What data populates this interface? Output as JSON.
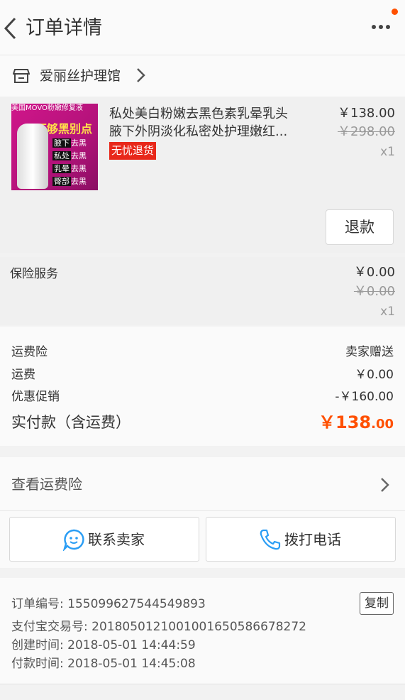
{
  "header": {
    "title": "订单详情",
    "back_icon": "chevron-left-icon",
    "more_icon": "more-icon",
    "accent": "#ff5000"
  },
  "shop": {
    "name": "爱丽丝护理馆",
    "icon": "shop-icon"
  },
  "product": {
    "thumb_top": "美国MOVO粉嫩修复液",
    "thumb_headline": "不够黑别点",
    "thumb_tags": [
      "腋下",
      "去黑",
      "私处",
      "去黑",
      "乳晕",
      "去黑",
      "臀部",
      "去黑"
    ],
    "title_line1": "私处美白粉嫩去黑色素乳晕乳头",
    "title_line2": "腋下外阴淡化私密处护理嫩红...",
    "badge": "无忧退货",
    "price": "￥138.00",
    "original_price": "￥298.00",
    "quantity": "x1",
    "refund_label": "退款"
  },
  "insurance": {
    "label": "保险服务",
    "price": "￥0.00",
    "original_price": "￥0.00",
    "quantity": "x1"
  },
  "summary": {
    "rows": [
      {
        "label": "运费险",
        "value": "卖家赠送"
      },
      {
        "label": "运费",
        "value": "￥0.00"
      },
      {
        "label": "优惠促销",
        "value": "-￥160.00"
      }
    ],
    "total_label": "实付款（含运费）",
    "total_int": "￥138",
    "total_dec": ".00"
  },
  "view_insurance": {
    "label": "查看运费险"
  },
  "actions": {
    "contact_label": "联系卖家",
    "call_label": "拨打电话"
  },
  "order_info": {
    "order_no": "订单编号: 1550996275445498 93",
    "alipay_no": "支付宝交易号: 2018050121001001650586678272",
    "created": "创建时间: 2018-05-01 14:44:59",
    "paid": "付款时间: 2018-05-01 14:45:08",
    "copy_label": "复制"
  }
}
